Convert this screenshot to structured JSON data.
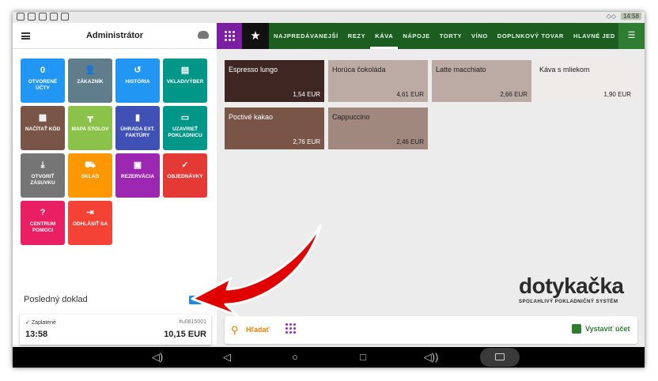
{
  "status_bar": {
    "clock": "14:58"
  },
  "header": {
    "title": "Administrátor"
  },
  "tiles": [
    {
      "icon": "0",
      "label": "OTVORENÉ ÚČTY",
      "color": "#2196f3"
    },
    {
      "icon": "person-icon",
      "label": "ZÁKAZNÍK",
      "color": "#607d8b"
    },
    {
      "icon": "history-icon",
      "label": "HISTÓRIA",
      "color": "#2196f3"
    },
    {
      "icon": "cash-icon",
      "label": "VKLAD/VÝBER",
      "color": "#009688"
    },
    {
      "icon": "qr-icon",
      "label": "NAČÍTAŤ KÓD",
      "color": "#795548"
    },
    {
      "icon": "table-icon",
      "label": "MAPA STOLOV",
      "color": "#8bc34a"
    },
    {
      "icon": "invoice-icon",
      "label": "ÚHRADA EXT. FAKTÚRY",
      "color": "#3f51b5"
    },
    {
      "icon": "close-register-icon",
      "label": "UZAVRIEŤ POKLADNICU",
      "color": "#009688"
    },
    {
      "icon": "drawer-icon",
      "label": "OTVORIŤ ZÁSUVKU",
      "color": "#757575"
    },
    {
      "icon": "forklift-icon",
      "label": "SKLAD",
      "color": "#ff9800"
    },
    {
      "icon": "calendar-icon",
      "label": "REZERVÁCIA",
      "color": "#9c27b0"
    },
    {
      "icon": "check-icon",
      "label": "OBJEDNÁVKY",
      "color": "#e53935"
    },
    {
      "icon": "help-icon",
      "label": "CENTRUM POMOCI",
      "color": "#e91e63"
    },
    {
      "icon": "logout-icon",
      "label": "ODHLÁSIŤ SA",
      "color": "#f44336"
    }
  ],
  "last_doc": {
    "title": "Posledný doklad",
    "status": "Zaplatené",
    "number": "#u0815001",
    "time": "13:58",
    "amount": "10,15 EUR"
  },
  "categories": {
    "items": [
      "NAJPREDÁVANEJŠÍ",
      "REZY",
      "KÁVA",
      "NÁPOJE",
      "TORTY",
      "VÍNO",
      "DOPLNKOVÝ TOVAR",
      "HLAVNÉ JED"
    ],
    "active": "KÁVA"
  },
  "products": [
    {
      "name": "Espresso lungo",
      "price": "1,54 EUR",
      "color": "#3e2723",
      "text_color": "#ffffff"
    },
    {
      "name": "Horúca čokoláda",
      "price": "4,61 EUR",
      "color": "#bcaaa4",
      "text_color": "#222222"
    },
    {
      "name": "Latte macchiato",
      "price": "2,66 EUR",
      "color": "#bcaaa4",
      "text_color": "#222222"
    },
    {
      "name": "Káva s mliekom",
      "price": "1,90 EUR",
      "color": "#efebe9",
      "text_color": "#222222"
    },
    {
      "name": "Poctivé kakao",
      "price": "2,76 EUR",
      "color": "#795548",
      "text_color": "#ffffff"
    },
    {
      "name": "Cappuccino",
      "price": "2,46 EUR",
      "color": "#a1887f",
      "text_color": "#222222"
    }
  ],
  "logo": {
    "brand": "dotykačka",
    "tagline": "SPOĽAHLIVÝ POKLADNIČNÝ SYSTÉM"
  },
  "bottom_bar": {
    "search_label": "Hľadať",
    "issue_label": "Vystaviť účet"
  },
  "colors": {
    "accent_green": "#1b5e20",
    "keypad_purple": "#7b1fa2",
    "search_orange": "#f57c00",
    "arrow_red": "#e10000"
  }
}
